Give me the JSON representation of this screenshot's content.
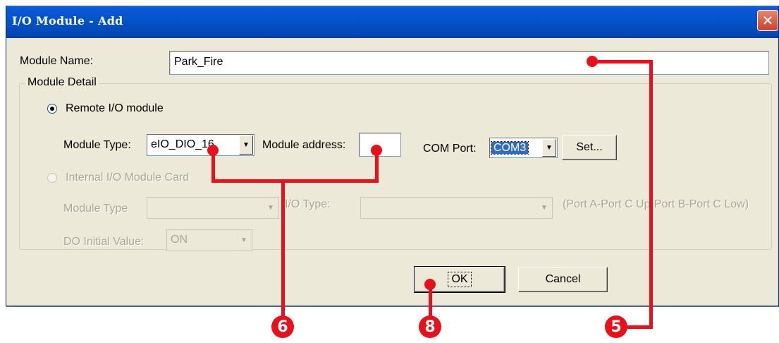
{
  "window": {
    "title": "I/O Module - Add",
    "close_glyph": "✕"
  },
  "module_name": {
    "label": "Module Name:",
    "value": "Park_Fire"
  },
  "module_detail": {
    "legend": "Module Detail",
    "remote": {
      "radio_label": "Remote I/O module",
      "checked": true,
      "module_type_label": "Module Type:",
      "module_type_value": "eIO_DIO_16",
      "address_label": "Module address:",
      "address_value": "",
      "com_port_label": "COM Port:",
      "com_port_value": "COM3",
      "set_button": "Set..."
    },
    "internal": {
      "radio_label": "Internal I/O Module Card",
      "checked": false,
      "module_type_label": "Module Type",
      "module_type_value": "",
      "io_type_label": "I/O Type:",
      "io_type_value": "",
      "port_hint": "(Port A-Port C Up-Port B-Port C Low)",
      "do_initial_label": "DO Initial Value:",
      "do_initial_value": "ON"
    }
  },
  "buttons": {
    "ok": "OK",
    "cancel": "Cancel"
  },
  "callouts": [
    {
      "number": "6"
    },
    {
      "number": "8"
    },
    {
      "number": "5"
    }
  ],
  "colors": {
    "callout": "#e8101a",
    "titlebar": "#0453c8",
    "dialog_bg": "#ece9d8"
  },
  "icons": {
    "dropdown": "chevron-down-icon",
    "close": "close-icon"
  }
}
